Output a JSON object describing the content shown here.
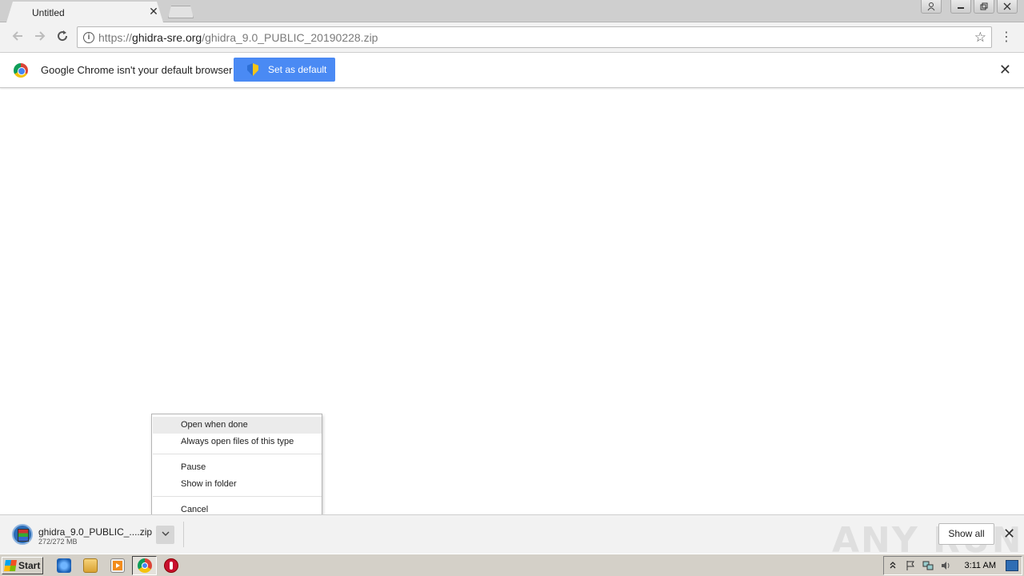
{
  "tab": {
    "title": "Untitled",
    "close": "✕"
  },
  "toolbar": {
    "url_prefix": "https://",
    "url_host": "ghidra-sre.org",
    "url_path": "/ghidra_9.0_PUBLIC_20190228.zip"
  },
  "infobar": {
    "message": "Google Chrome isn't your default browser",
    "button_label": "Set as default",
    "close": "✕"
  },
  "context_menu": {
    "items": [
      "Open when done",
      "Always open files of this type",
      "Pause",
      "Show in folder",
      "Cancel"
    ]
  },
  "download": {
    "filename": "ghidra_9.0_PUBLIC_....zip",
    "size": "272/272 MB",
    "show_all": "Show all",
    "close": "✕"
  },
  "watermark": "ANY RUN",
  "taskbar": {
    "start_label": "Start",
    "clock": "3:11 AM"
  },
  "colors": {
    "accent_button": "#4a8af4",
    "tab_strip": "#cfcfcf",
    "taskbar": "#d4d0c8"
  }
}
